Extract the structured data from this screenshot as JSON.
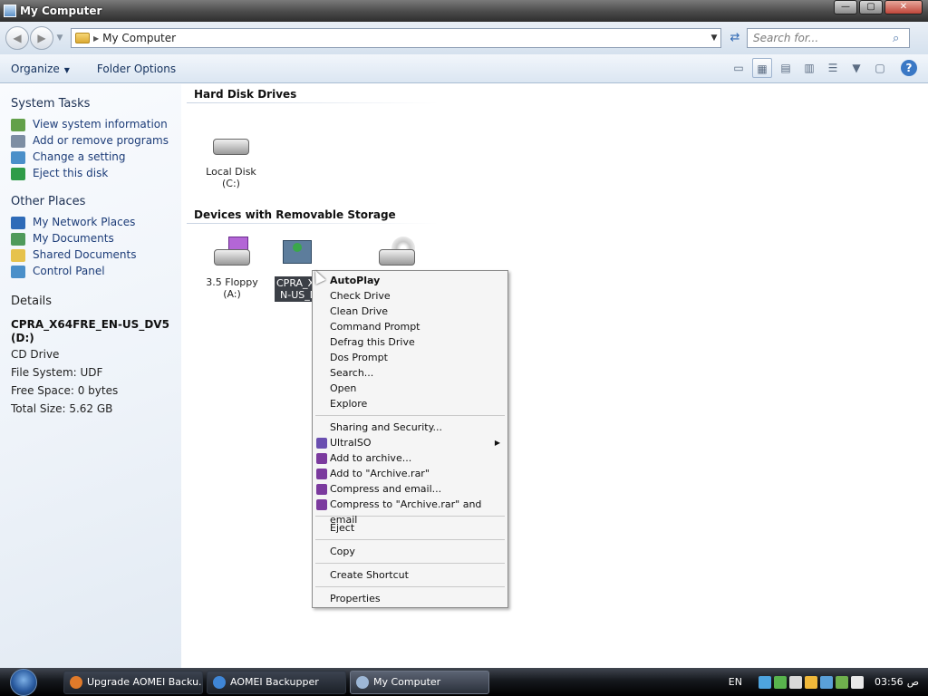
{
  "window": {
    "title": "My Computer"
  },
  "window_buttons": {
    "minimize": "—",
    "maximize": "▢",
    "close": "✕"
  },
  "address": {
    "path": "My Computer",
    "search_placeholder": "Search for..."
  },
  "toolbar": {
    "organize": "Organize",
    "folder_options": "Folder Options"
  },
  "sidebar": {
    "system_tasks": {
      "title": "System Tasks",
      "items": [
        {
          "label": "View system information",
          "icon": "info-check-icon",
          "color": "#63a04a"
        },
        {
          "label": "Add or remove programs",
          "icon": "programs-icon",
          "color": "#7d8ea3"
        },
        {
          "label": "Change a setting",
          "icon": "control-panel-icon",
          "color": "#4a8fc9"
        },
        {
          "label": "Eject this disk",
          "icon": "eject-icon",
          "color": "#2f9c48"
        }
      ]
    },
    "other_places": {
      "title": "Other Places",
      "items": [
        {
          "label": "My Network Places",
          "icon": "network-icon",
          "color": "#2e6bb8"
        },
        {
          "label": "My Documents",
          "icon": "documents-icon",
          "color": "#4f9a5b"
        },
        {
          "label": "Shared Documents",
          "icon": "shared-folder-icon",
          "color": "#e6c24c"
        },
        {
          "label": "Control Panel",
          "icon": "control-panel-icon",
          "color": "#4a8fc9"
        }
      ]
    },
    "details": {
      "title": "Details",
      "name": "CPRA_X64FRE_EN-US_DV5 (D:)",
      "type": "CD Drive",
      "file_system": "File System: UDF",
      "free_space": "Free Space: 0 bytes",
      "total_size": "Total Size: 5.62 GB"
    }
  },
  "content": {
    "groups": [
      {
        "title": "Hard Disk Drives"
      },
      {
        "title": "Devices with Removable Storage"
      }
    ],
    "drives": {
      "local_disk": "Local Disk (C:)",
      "floppy": "3.5 Floppy (A:)",
      "cd_selected_line1": "CPRA_X",
      "cd_selected_line2": "N-US_D"
    }
  },
  "context_menu": {
    "items": [
      {
        "label": "AutoPlay",
        "bold": true
      },
      {
        "label": "Check Drive"
      },
      {
        "label": "Clean Drive"
      },
      {
        "label": "Command Prompt"
      },
      {
        "label": "Defrag this Drive"
      },
      {
        "label": "Dos Prompt"
      },
      {
        "label": "Search..."
      },
      {
        "label": "Open"
      },
      {
        "label": "Explore"
      },
      {
        "separator": true
      },
      {
        "label": "Sharing and Security..."
      },
      {
        "label": "UltraISO",
        "submenu": true,
        "icon": "ultraiso-icon",
        "color": "#6a4fb0"
      },
      {
        "label": "Add to archive...",
        "icon": "winrar-icon",
        "color": "#7b3a9e"
      },
      {
        "label": "Add to \"Archive.rar\"",
        "icon": "winrar-icon",
        "color": "#7b3a9e"
      },
      {
        "label": "Compress and email...",
        "icon": "winrar-icon",
        "color": "#7b3a9e"
      },
      {
        "label": "Compress to \"Archive.rar\" and email",
        "icon": "winrar-icon",
        "color": "#7b3a9e"
      },
      {
        "separator": true
      },
      {
        "label": "Eject"
      },
      {
        "separator": true
      },
      {
        "label": "Copy"
      },
      {
        "separator": true
      },
      {
        "label": "Create Shortcut"
      },
      {
        "separator": true
      },
      {
        "label": "Properties"
      }
    ]
  },
  "taskbar": {
    "tasks": [
      {
        "label": "Upgrade AOMEI Backu...",
        "icon": "firefox-icon",
        "color": "#e07a2a"
      },
      {
        "label": "AOMEI Backupper",
        "icon": "aomei-icon",
        "color": "#3f86d6"
      },
      {
        "label": "My Computer",
        "icon": "computer-icon",
        "color": "#9db7d6",
        "active": true
      }
    ],
    "language": "EN",
    "clock": "03:56",
    "ampm": "ص",
    "tray_colors": [
      "#4ea4df",
      "#58b34d",
      "#d9d9d9",
      "#f0b83a",
      "#5aa0d8",
      "#6fb04d",
      "#e8e8e8"
    ]
  }
}
